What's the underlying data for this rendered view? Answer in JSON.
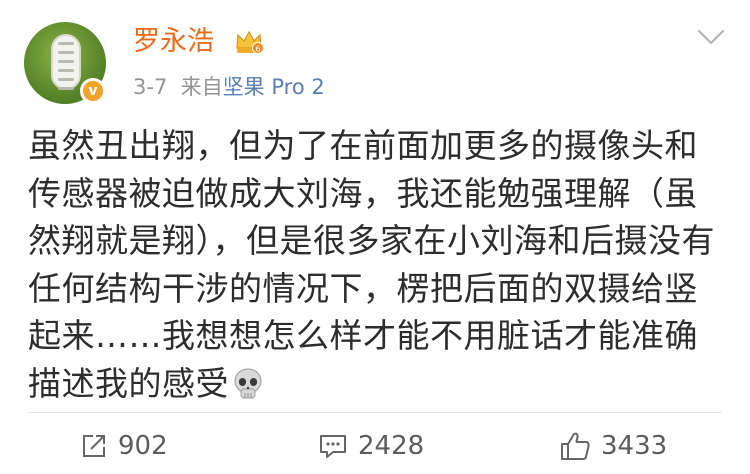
{
  "post": {
    "username": "罗永浩",
    "date": "3-7",
    "source_prefix": "来自",
    "source_device": "坚果 Pro 2",
    "badge_letter": "v",
    "content": "虽然丑出翔，但为了在前面加更多的摄像头和传感器被迫做成大刘海，我还能勉强理解（虽然翔就是翔），但是很多家在小刘海和后摄没有任何结构干涉的情况下，楞把后面的双摄给竖起来……我想想怎么样才能不用脏话才能准确描述我的感受",
    "emoji": "skull-emoji"
  },
  "actions": {
    "repost_count": "902",
    "comment_count": "2428",
    "like_count": "3433"
  },
  "colors": {
    "username": "#ec6a1a",
    "device_link": "#5a7fb0",
    "meta": "#939393",
    "badge": "#f3a22a"
  }
}
